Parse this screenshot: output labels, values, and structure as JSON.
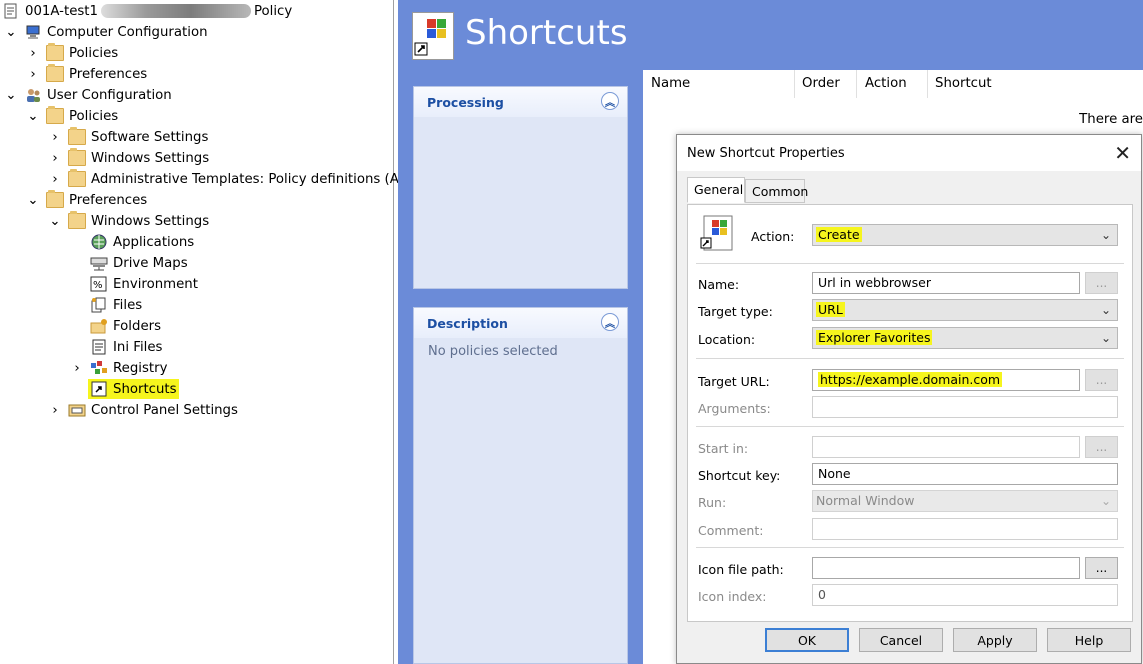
{
  "tree": {
    "root_label": "001A-test1",
    "root_label_suffix": "Policy",
    "items": [
      {
        "label": "Computer Configuration"
      },
      {
        "label": "Policies"
      },
      {
        "label": "Preferences"
      },
      {
        "label": "User Configuration"
      },
      {
        "label": "Policies"
      },
      {
        "label": "Software Settings"
      },
      {
        "label": "Windows Settings"
      },
      {
        "label": "Administrative Templates: Policy definitions (ADI"
      },
      {
        "label": "Preferences"
      },
      {
        "label": "Windows Settings"
      },
      {
        "label": "Applications"
      },
      {
        "label": "Drive Maps"
      },
      {
        "label": "Environment"
      },
      {
        "label": "Files"
      },
      {
        "label": "Folders"
      },
      {
        "label": "Ini Files"
      },
      {
        "label": "Registry"
      },
      {
        "label": "Shortcuts"
      },
      {
        "label": "Control Panel Settings"
      }
    ]
  },
  "header": {
    "title": "Shortcuts"
  },
  "panels": {
    "processing": {
      "title": "Processing"
    },
    "description": {
      "title": "Description",
      "body": "No policies selected"
    }
  },
  "list": {
    "columns": [
      "Name",
      "Order",
      "Action",
      "Shortcut"
    ],
    "empty_text": "There are"
  },
  "dialog": {
    "title": "New Shortcut Properties",
    "tabs": [
      "General",
      "Common"
    ],
    "action_label": "Action:",
    "action_value": "Create",
    "name_label": "Name:",
    "name_value": "Url in webbrowser",
    "target_type_label": "Target type:",
    "target_type_value": "URL",
    "location_label": "Location:",
    "location_value": "Explorer Favorites",
    "target_url_label": "Target URL:",
    "target_url_value": "https://example.domain.com",
    "arguments_label": "Arguments:",
    "start_in_label": "Start in:",
    "shortcut_key_label": "Shortcut key:",
    "shortcut_key_value": "None",
    "run_label": "Run:",
    "run_value": "Normal Window",
    "comment_label": "Comment:",
    "icon_file_path_label": "Icon file path:",
    "icon_index_label": "Icon index:",
    "icon_index_value": "0",
    "ellipsis": "...",
    "buttons": {
      "ok": "OK",
      "cancel": "Cancel",
      "apply": "Apply",
      "help": "Help"
    }
  },
  "colors": {
    "highlight": "#f6f51d",
    "pane_blue": "#6b8bd8",
    "panel_title": "#1c4fa3"
  }
}
